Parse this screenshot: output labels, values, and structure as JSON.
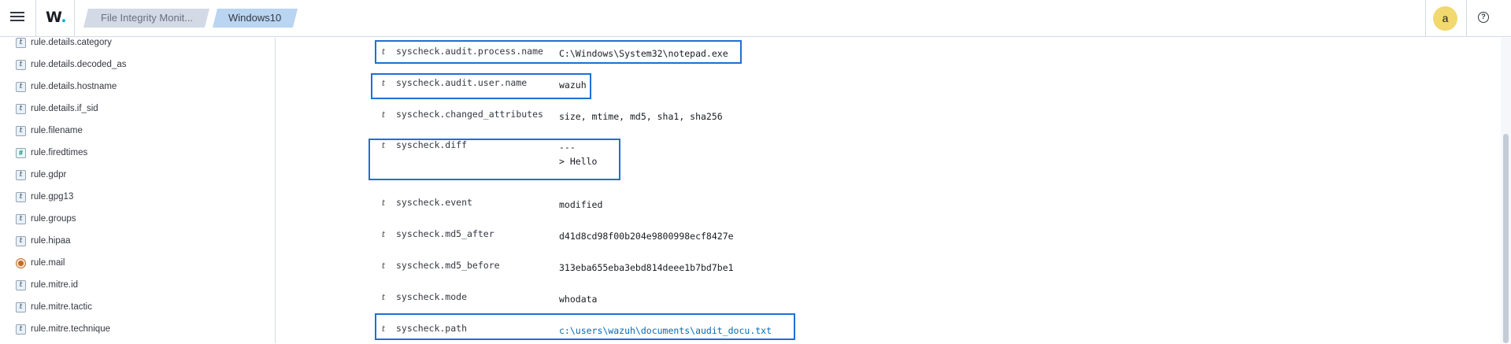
{
  "header": {
    "logo_text": "W",
    "logo_dot": ".",
    "breadcrumbs": [
      "File Integrity Monit...",
      "Windows10"
    ],
    "avatar_letter": "a",
    "help_symbol": "?"
  },
  "sidebar": {
    "fields": [
      {
        "type": "t",
        "label": "rule.details.category"
      },
      {
        "type": "t",
        "label": "rule.details.decoded_as"
      },
      {
        "type": "t",
        "label": "rule.details.hostname"
      },
      {
        "type": "t",
        "label": "rule.details.if_sid"
      },
      {
        "type": "t",
        "label": "rule.filename"
      },
      {
        "type": "#",
        "label": "rule.firedtimes"
      },
      {
        "type": "t",
        "label": "rule.gdpr"
      },
      {
        "type": "t",
        "label": "rule.gpg13"
      },
      {
        "type": "t",
        "label": "rule.groups"
      },
      {
        "type": "t",
        "label": "rule.hipaa"
      },
      {
        "type": "geo",
        "label": "rule.mail"
      },
      {
        "type": "t",
        "label": "rule.mitre.id"
      },
      {
        "type": "t",
        "label": "rule.mitre.tactic"
      },
      {
        "type": "t",
        "label": "rule.mitre.technique"
      }
    ]
  },
  "document": {
    "type_icon": "t",
    "rows": [
      {
        "key": "syscheck.audit.process.name",
        "value": "C:\\Windows\\System32\\notepad.exe"
      },
      {
        "key": "syscheck.audit.user.name",
        "value": "wazuh"
      },
      {
        "key": "syscheck.changed_attributes",
        "value": "size, mtime, md5, sha1, sha256"
      },
      {
        "key": "syscheck.diff",
        "value": "---",
        "value2": "> Hello"
      },
      {
        "key": "syscheck.event",
        "value": "modified"
      },
      {
        "key": "syscheck.md5_after",
        "value": "d41d8cd98f00b204e9800998ecf8427e"
      },
      {
        "key": "syscheck.md5_before",
        "value": "313eba655eba3ebd814deee1b7bd7be1"
      },
      {
        "key": "syscheck.mode",
        "value": "whodata"
      },
      {
        "key": "syscheck.path",
        "value": "c:\\users\\wazuh\\documents\\audit_docu.txt"
      }
    ]
  },
  "colors": {
    "highlight": "#1f6fd6",
    "link": "#006bb8",
    "avatar": "#f1d86f"
  }
}
